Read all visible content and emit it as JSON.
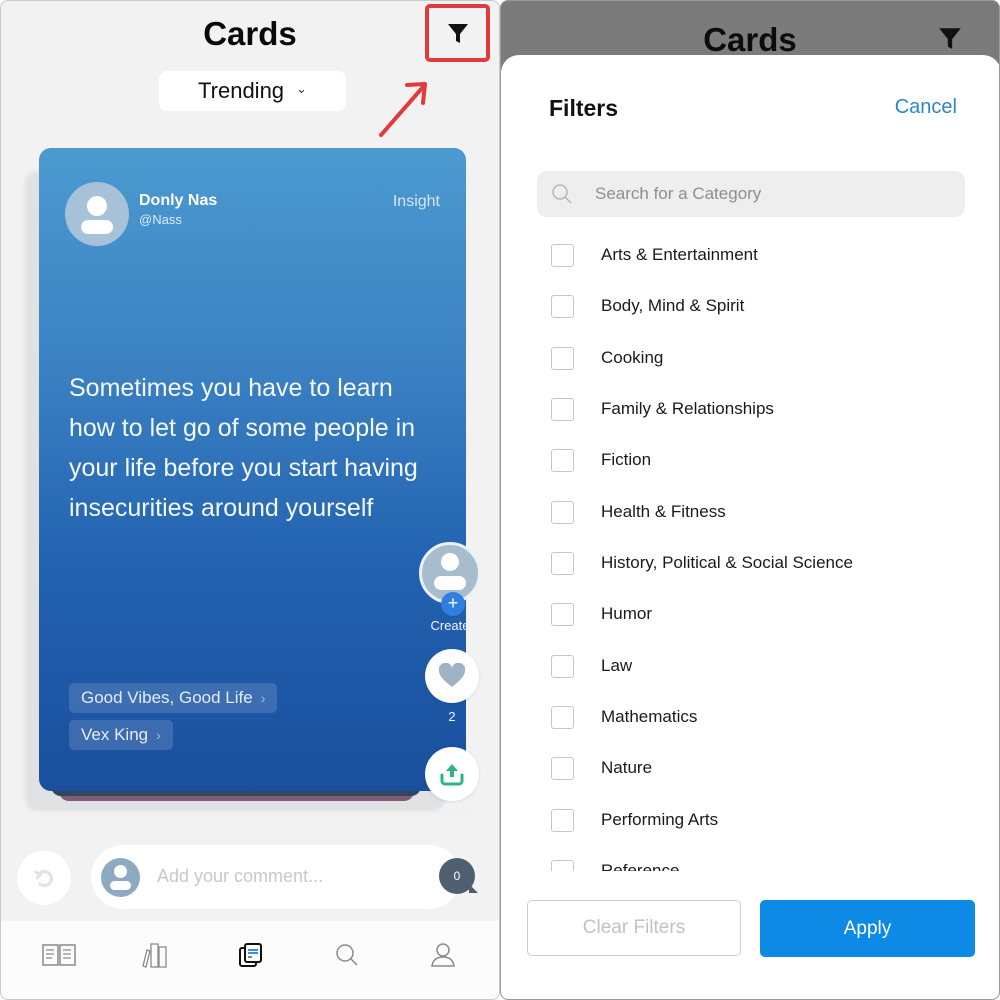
{
  "left_screen": {
    "title": "Cards",
    "filter_button_icon": "funnel-icon",
    "sort_dropdown": {
      "selected": "Trending",
      "icon": "chevron-down-icon"
    },
    "annotation": {
      "highlight_color": "#e03b3b",
      "arrow_color": "#e03b3b"
    },
    "card": {
      "author_name": "Donly Nas",
      "author_handle": "@Nass",
      "type": "Insight",
      "quote": "Sometimes you have to learn how to let go of some people in your life before you start having insecurities around yourself",
      "tags": [
        {
          "label": "Good Vibes, Good Life"
        },
        {
          "label": "Vex King"
        }
      ],
      "gradient_top": "#4c9ad0",
      "gradient_bottom": "#1a4f9d"
    },
    "actions": {
      "create_label": "Create",
      "like_count": "2",
      "share_label": "Share"
    },
    "comment": {
      "placeholder": "Add your comment...",
      "count": "0"
    },
    "tabbar": [
      {
        "name": "library",
        "icon": "open-book-icon"
      },
      {
        "name": "books",
        "icon": "bookshelf-icon"
      },
      {
        "name": "cards",
        "icon": "cards-icon",
        "active": true
      },
      {
        "name": "search",
        "icon": "search-icon"
      },
      {
        "name": "profile",
        "icon": "user-icon"
      }
    ]
  },
  "right_screen": {
    "background_title": "Cards",
    "sheet": {
      "title": "Filters",
      "cancel_label": "Cancel",
      "search_placeholder": "Search for a Category",
      "categories": [
        {
          "label": "Arts & Entertainment",
          "checked": false
        },
        {
          "label": "Body, Mind & Spirit",
          "checked": false
        },
        {
          "label": "Cooking",
          "checked": false
        },
        {
          "label": "Family & Relationships",
          "checked": false
        },
        {
          "label": "Fiction",
          "checked": false
        },
        {
          "label": "Health & Fitness",
          "checked": false
        },
        {
          "label": "History, Political & Social Science",
          "checked": false
        },
        {
          "label": "Humor",
          "checked": false
        },
        {
          "label": "Law",
          "checked": false
        },
        {
          "label": "Mathematics",
          "checked": false
        },
        {
          "label": "Nature",
          "checked": false
        },
        {
          "label": "Performing Arts",
          "checked": false
        },
        {
          "label": "Reference",
          "checked": false
        }
      ],
      "clear_label": "Clear Filters",
      "apply_label": "Apply",
      "apply_color": "#0d8ae6",
      "cancel_color": "#2f86c7"
    }
  }
}
